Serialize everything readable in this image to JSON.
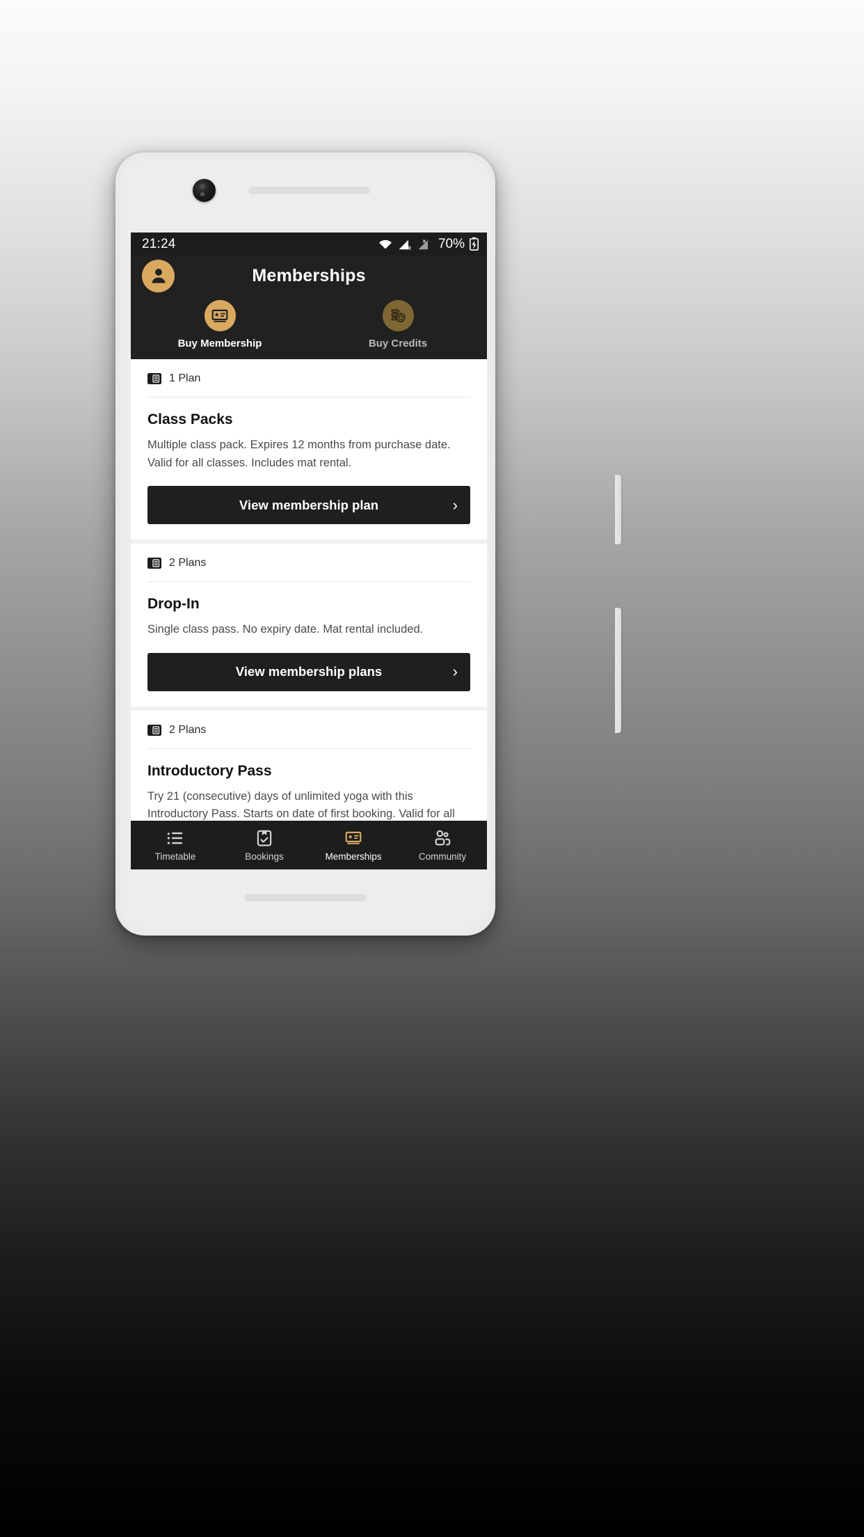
{
  "statusbar": {
    "time": "21:24",
    "battery_percent": "70%",
    "icons": [
      "wifi-icon",
      "signal-roaming-icon",
      "signal-nosim-icon",
      "battery-charging-icon"
    ]
  },
  "header": {
    "title": "Memberships",
    "avatar_icon": "account-avatar-icon",
    "accent_color": "#d9a960",
    "background_color": "#212121",
    "quick_actions": [
      {
        "label": "Buy Membership",
        "icon": "membership-card-icon",
        "enabled": true
      },
      {
        "label": "Buy Credits",
        "icon": "coins-icon",
        "enabled": false
      }
    ]
  },
  "main": {
    "cards": [
      {
        "plan_count": "1 Plan",
        "plan_icon": "plan-list-icon",
        "title": "Class Packs",
        "description": "Multiple class pack. Expires 12 months from purchase date. Valid for all classes. Includes mat rental.",
        "button_label": "View membership plan",
        "button_chevron": "chevron-right-icon"
      },
      {
        "plan_count": "2 Plans",
        "plan_icon": "plan-list-icon",
        "title": "Drop-In",
        "description": "Single class pass. No expiry date. Mat rental included.",
        "button_label": "View membership plans",
        "button_chevron": "chevron-right-icon"
      },
      {
        "plan_count": "2 Plans",
        "plan_icon": "plan-list-icon",
        "title": "Introductory Pass",
        "description": "Try 21 (consecutive) days of unlimited yoga with this Introductory Pass. Starts on date of first booking. Valid for all"
      }
    ]
  },
  "bottom_nav": {
    "active": "Memberships",
    "active_color": "#d9a960",
    "items": [
      {
        "label": "Timetable",
        "icon": "timetable-list-icon"
      },
      {
        "label": "Bookings",
        "icon": "clipboard-check-icon"
      },
      {
        "label": "Memberships",
        "icon": "membership-card-icon"
      },
      {
        "label": "Community",
        "icon": "people-group-icon"
      }
    ]
  }
}
